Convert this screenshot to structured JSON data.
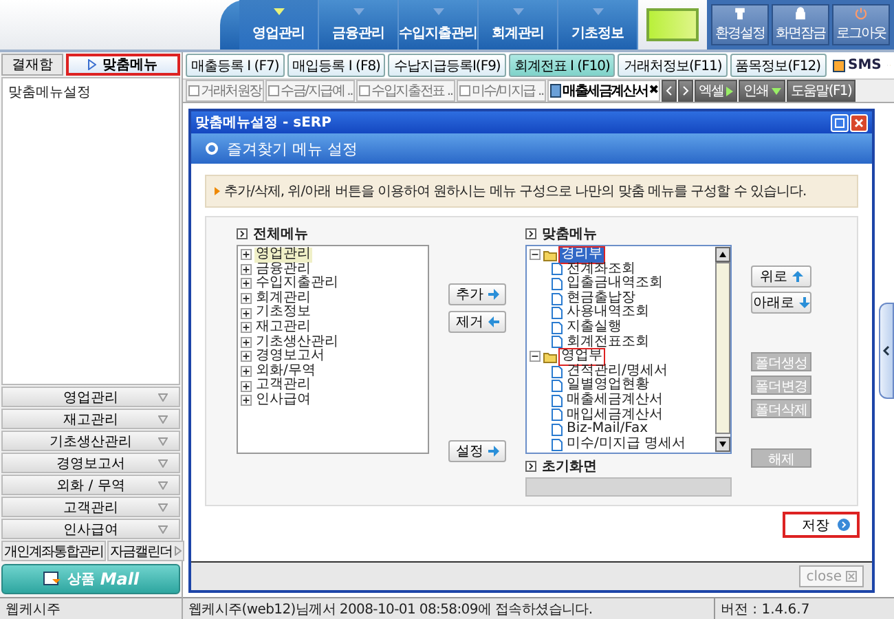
{
  "header": {
    "nav": [
      {
        "label": "영업관리",
        "selected": true
      },
      {
        "label": "금융관리",
        "selected": false
      },
      {
        "label": "수입지출관리",
        "selected": false
      },
      {
        "label": "회계관리",
        "selected": false
      },
      {
        "label": "기초정보",
        "selected": false
      }
    ],
    "tools": [
      {
        "label": "환경설정",
        "kind": "settings"
      },
      {
        "label": "화면잠금",
        "kind": "lock"
      },
      {
        "label": "로그아웃",
        "kind": "power"
      }
    ]
  },
  "left_tabs": [
    {
      "label": "결재함",
      "selected": false,
      "highlighted": false
    },
    {
      "label": "맞춤메뉴",
      "selected": true,
      "highlighted": true
    }
  ],
  "toolbar": {
    "buttons": [
      {
        "label": "매출등록 I (F7)",
        "selected": false
      },
      {
        "label": "매입등록 I (F8)",
        "selected": false
      },
      {
        "label": "수납지급등록I(F9)",
        "selected": false
      },
      {
        "label": "회계전표 I (F10)",
        "selected": true
      },
      {
        "label": "거래처정보(F11)",
        "selected": false
      },
      {
        "label": "품목정보(F12)",
        "selected": false
      }
    ],
    "sms": "SMS"
  },
  "doc_tabs": [
    {
      "label": "거래처원장",
      "selected": false
    },
    {
      "label": "수금/지급예 ..",
      "selected": false
    },
    {
      "label": "수입지출전표 ..",
      "selected": false
    },
    {
      "label": "미수/미지급 ..",
      "selected": false
    },
    {
      "label": "매출세금계산서",
      "selected": true,
      "close": "✖"
    }
  ],
  "doc_actions": [
    {
      "label": "엑셀",
      "kind": "play"
    },
    {
      "label": "인쇄",
      "kind": "drop"
    },
    {
      "label": "도움말(F1)",
      "kind": "none"
    }
  ],
  "sidebar": {
    "tree": [
      {
        "label": "맞춤메뉴설정"
      }
    ],
    "sections": [
      "영업관리",
      "재고관리",
      "기초생산관리",
      "경영보고서",
      "외화 / 무역",
      "고객관리",
      "인사급여"
    ],
    "links": [
      "개인계좌통합관리",
      "자금캘린더"
    ],
    "mall": {
      "label": "상품",
      "brand": "Mall"
    },
    "status": "웹케시주"
  },
  "dialog": {
    "title": "맞춤메뉴설정 - sERP",
    "heading": "즐겨찾기 메뉴 설정",
    "note": "추가/삭제, 위/아래 버튼을 이용하여 원하시는 메뉴 구성으로 나만의 맞춤 메뉴를 구성할 수 있습니다.",
    "all_menu": {
      "label": "전체메뉴",
      "items": [
        {
          "label": "영업관리",
          "expanded": false,
          "selected": true
        },
        {
          "label": "금융관리",
          "expanded": false,
          "selected": false
        },
        {
          "label": "수입지출관리",
          "expanded": false,
          "selected": false
        },
        {
          "label": "회계관리",
          "expanded": false,
          "selected": false
        },
        {
          "label": "기초정보",
          "expanded": false,
          "selected": false
        },
        {
          "label": "재고관리",
          "expanded": false,
          "selected": false
        },
        {
          "label": "기초생산관리",
          "expanded": false,
          "selected": false
        },
        {
          "label": "경영보고서",
          "expanded": false,
          "selected": false
        },
        {
          "label": "외화/무역",
          "expanded": false,
          "selected": false
        },
        {
          "label": "고객관리",
          "expanded": false,
          "selected": false
        },
        {
          "label": "인사급여",
          "expanded": false,
          "selected": false
        }
      ]
    },
    "my_menu": {
      "label": "맞춤메뉴",
      "items": [
        {
          "label": "경리부",
          "expanded": true,
          "selected": true,
          "highlighted": true,
          "children": [
            {
              "label": "전계좌조회"
            },
            {
              "label": "입출금내역조회"
            },
            {
              "label": "현금출납장"
            },
            {
              "label": "사용내역조회"
            },
            {
              "label": "지출실행"
            },
            {
              "label": "회계전표조회"
            }
          ]
        },
        {
          "label": "영업부",
          "expanded": true,
          "selected": false,
          "highlighted": true,
          "children": [
            {
              "label": "견적관리/명세서"
            },
            {
              "label": "일별영업현황"
            },
            {
              "label": "매출세금계산서"
            },
            {
              "label": "매입세금계산서"
            },
            {
              "label": "Biz-Mail/Fax"
            },
            {
              "label": "미수/미지급 명세서"
            }
          ]
        }
      ]
    },
    "move_buttons": [
      {
        "label": "추가",
        "kind": "right"
      },
      {
        "label": "제거",
        "kind": "left"
      }
    ],
    "set_button": {
      "label": "설정",
      "kind": "right"
    },
    "order_buttons": [
      {
        "label": "위로",
        "kind": "up"
      },
      {
        "label": "아래로",
        "kind": "down"
      }
    ],
    "folder_buttons": [
      {
        "label": "폴더생성",
        "disabled": true
      },
      {
        "label": "폴더변경",
        "disabled": true
      },
      {
        "label": "폴더삭제",
        "disabled": true
      }
    ],
    "start": {
      "label": "초기화면"
    },
    "release": {
      "label": "해제",
      "disabled": true
    },
    "save": {
      "label": "저장",
      "highlighted": true
    },
    "close": {
      "label": "close"
    }
  },
  "status_bar": {
    "message": "웹케시주(web12)님께서 2008-10-01 08:58:09에 접속하셨습니다.",
    "version": "버전 : 1.4.6.7"
  }
}
